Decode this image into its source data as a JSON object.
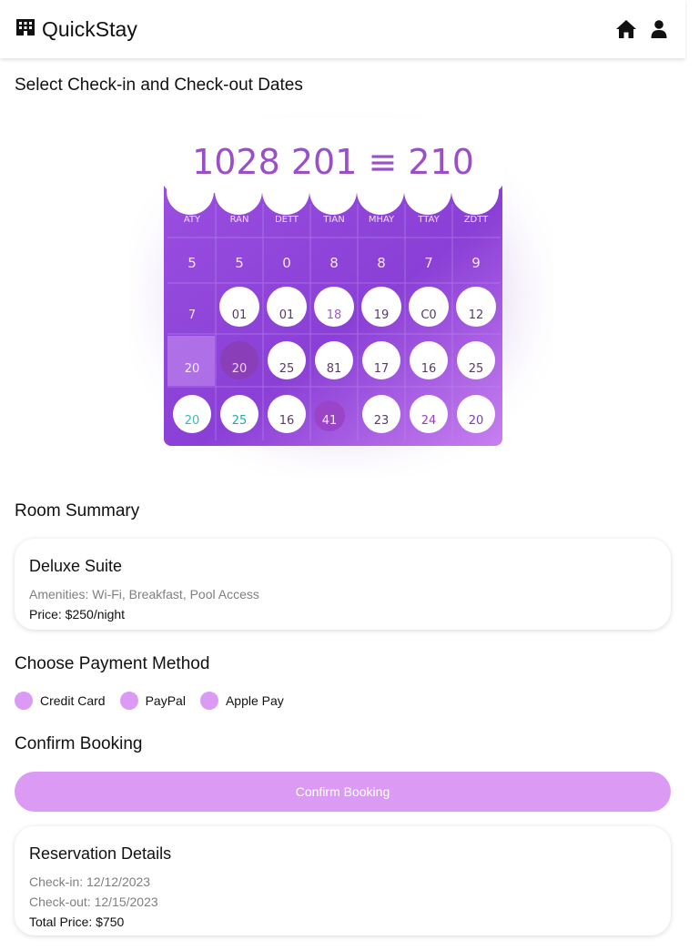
{
  "app": {
    "title": "QuickStay"
  },
  "header_icons": [
    "hotel-icon",
    "home-icon",
    "account-icon"
  ],
  "dates_section": {
    "title": "Select Check-in and Check-out Dates"
  },
  "calendar_image": {
    "header_text": "1028 201 ≡ 210",
    "weekdays": [
      "ATY",
      "RAN",
      "DETT",
      "TIAN",
      "MHAY",
      "TTAY",
      "ZDTT"
    ],
    "row1": [
      "5",
      "5",
      "0",
      "8",
      "8",
      "7",
      "9"
    ],
    "row2": [
      "7",
      "01",
      "01",
      "18",
      "19",
      "C0",
      "12"
    ],
    "row3": [
      "20",
      "20",
      "25",
      "81",
      "17",
      "16",
      "25"
    ],
    "row4": [
      "20",
      "25",
      "16",
      "41",
      "23",
      "24",
      "20"
    ]
  },
  "room_summary": {
    "title": "Room Summary",
    "name": "Deluxe Suite",
    "amenities": "Amenities: Wi-Fi, Breakfast, Pool Access",
    "price": "Price: $250/night"
  },
  "payment": {
    "title": "Choose Payment Method",
    "options": [
      "Credit Card",
      "PayPal",
      "Apple Pay"
    ]
  },
  "confirm": {
    "title": "Confirm Booking",
    "button_label": "Confirm Booking"
  },
  "reservation": {
    "title": "Reservation Details",
    "check_in": "Check-in: 12/12/2023",
    "check_out": "Check-out: 12/15/2023",
    "total": "Total Price: $750"
  },
  "colors": {
    "accent": "#db9bf5",
    "calendar_purple": "#8e44d9",
    "calendar_light": "#c77ff0"
  }
}
